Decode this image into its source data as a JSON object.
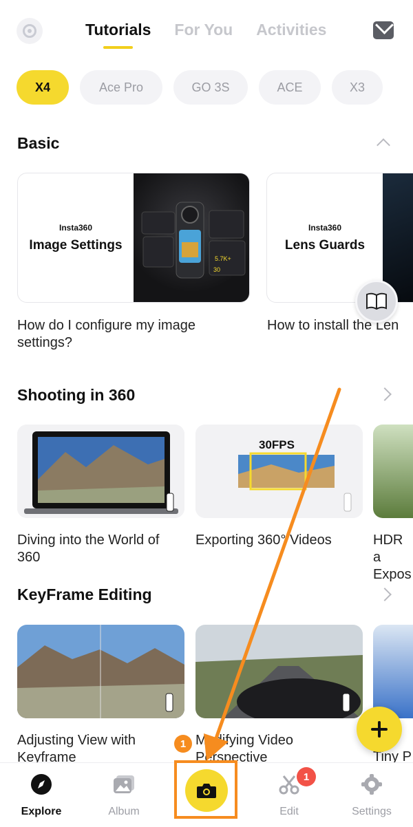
{
  "header": {
    "tabs": [
      {
        "label": "Tutorials",
        "active": true
      },
      {
        "label": "For You",
        "active": false
      },
      {
        "label": "Activities",
        "active": false
      }
    ]
  },
  "chips": [
    "X4",
    "Ace Pro",
    "GO 3S",
    "ACE",
    "X3"
  ],
  "sections": {
    "basic": {
      "title": "Basic",
      "cards": [
        {
          "brand": "Insta360",
          "title": "Image Settings",
          "caption": "How do I configure my image settings?"
        },
        {
          "brand": "Insta360",
          "title": "Lens Guards",
          "caption": "How to install the Len"
        }
      ]
    },
    "shooting": {
      "title": "Shooting in 360",
      "cards": [
        {
          "caption": "Diving into the World of 360"
        },
        {
          "caption": "Exporting 360° Videos",
          "overlay": "30FPS"
        },
        {
          "caption": "HDR a Expos"
        }
      ]
    },
    "keyframe": {
      "title": "KeyFrame Editing",
      "cards": [
        {
          "caption": "Adjusting View with Keyframe"
        },
        {
          "caption": "Modifying Video Perspective"
        },
        {
          "caption": "Tiny P"
        }
      ]
    }
  },
  "nav": {
    "items": [
      {
        "label": "Explore",
        "active": true
      },
      {
        "label": "Album",
        "active": false
      },
      {
        "label": "",
        "active": false
      },
      {
        "label": "Edit",
        "active": false,
        "badge": "1"
      },
      {
        "label": "Settings",
        "active": false
      }
    ]
  },
  "annotation": {
    "step": "1"
  },
  "colors": {
    "accent": "#f5d92e",
    "highlight": "#f68c1f",
    "badge": "#f25247"
  }
}
